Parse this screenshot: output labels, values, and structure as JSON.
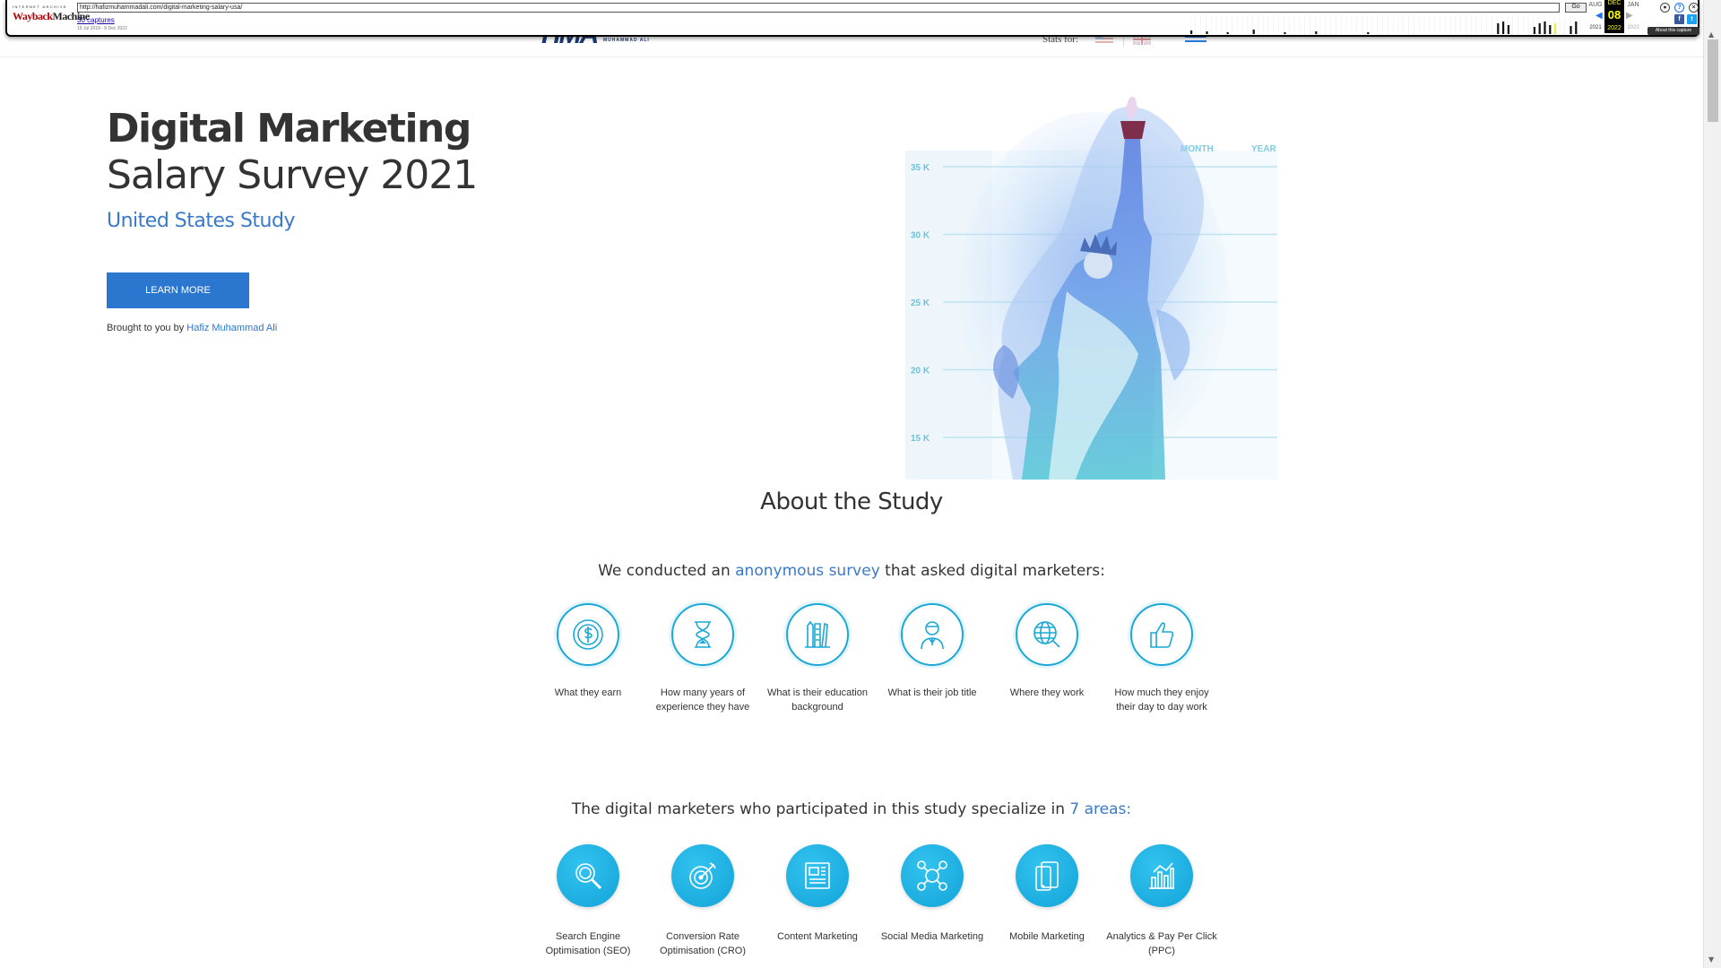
{
  "wayback": {
    "logo_top": "INTERNET ARCHIVE",
    "logo_main_a": "Wayback",
    "logo_main_b": "Machine",
    "url": "http://hafizmuhammadali.com/digital-marketing-salary-usa/",
    "go_label": "Go",
    "captures": "30 captures",
    "date_range": "19 Jul 2018 - 8 Dec 2022",
    "month_prev": "AUG",
    "month_sel": "DEC",
    "month_next": "JAN",
    "day": "08",
    "year_prev": "2021",
    "year_sel": "2022",
    "year_next": "2023",
    "about": "About this capture"
  },
  "header": {
    "logo_mark": "HMA",
    "logo_text": "MUHAMMAD ALI",
    "stats_for": "Stats for:"
  },
  "hero": {
    "title_line1": "Digital Marketing",
    "title_line2": "Salary Survey 2021",
    "subtitle": "United States Study",
    "cta": "LEARN MORE",
    "brought_prefix": "Brought to you by ",
    "brought_link": "Hafiz Muhammad Ali"
  },
  "chart_data": {
    "type": "bar",
    "tabs": [
      "MONTH",
      "YEAR"
    ],
    "y_ticks": [
      "35 K",
      "30 K",
      "25 K",
      "20 K",
      "15 K"
    ],
    "ylim": [
      15000,
      35000
    ]
  },
  "about": {
    "title": "About the Study",
    "survey_prefix": "We conducted an ",
    "survey_link": "anonymous survey",
    "survey_suffix": " that asked digital marketers:",
    "questions": [
      {
        "icon": "dollar-icon",
        "label": "What they earn"
      },
      {
        "icon": "hourglass-icon",
        "label": "How many years of experience they have"
      },
      {
        "icon": "pencils-icon",
        "label": "What is their education background"
      },
      {
        "icon": "person-icon",
        "label": "What is their job title"
      },
      {
        "icon": "globe-search-icon",
        "label": "Where they work"
      },
      {
        "icon": "thumbs-up-icon",
        "label": "How much they enjoy their day to day work"
      }
    ],
    "areas_prefix": "The digital marketers who participated in this study specialize in ",
    "areas_link": "7 areas:",
    "areas": [
      {
        "icon": "magnifier-icon",
        "label": "Search Engine Optimisation (SEO)"
      },
      {
        "icon": "target-icon",
        "label": "Conversion Rate Optimisation (CRO)"
      },
      {
        "icon": "content-icon",
        "label": "Content Marketing"
      },
      {
        "icon": "social-icon",
        "label": "Social Media Marketing"
      },
      {
        "icon": "mobile-icon",
        "label": "Mobile Marketing"
      },
      {
        "icon": "analytics-icon",
        "label": "Analytics & Pay Per Click (PPC)"
      }
    ]
  },
  "colors": {
    "accent": "#2b77d0",
    "teal": "#1aa8d6",
    "text": "#333333"
  }
}
